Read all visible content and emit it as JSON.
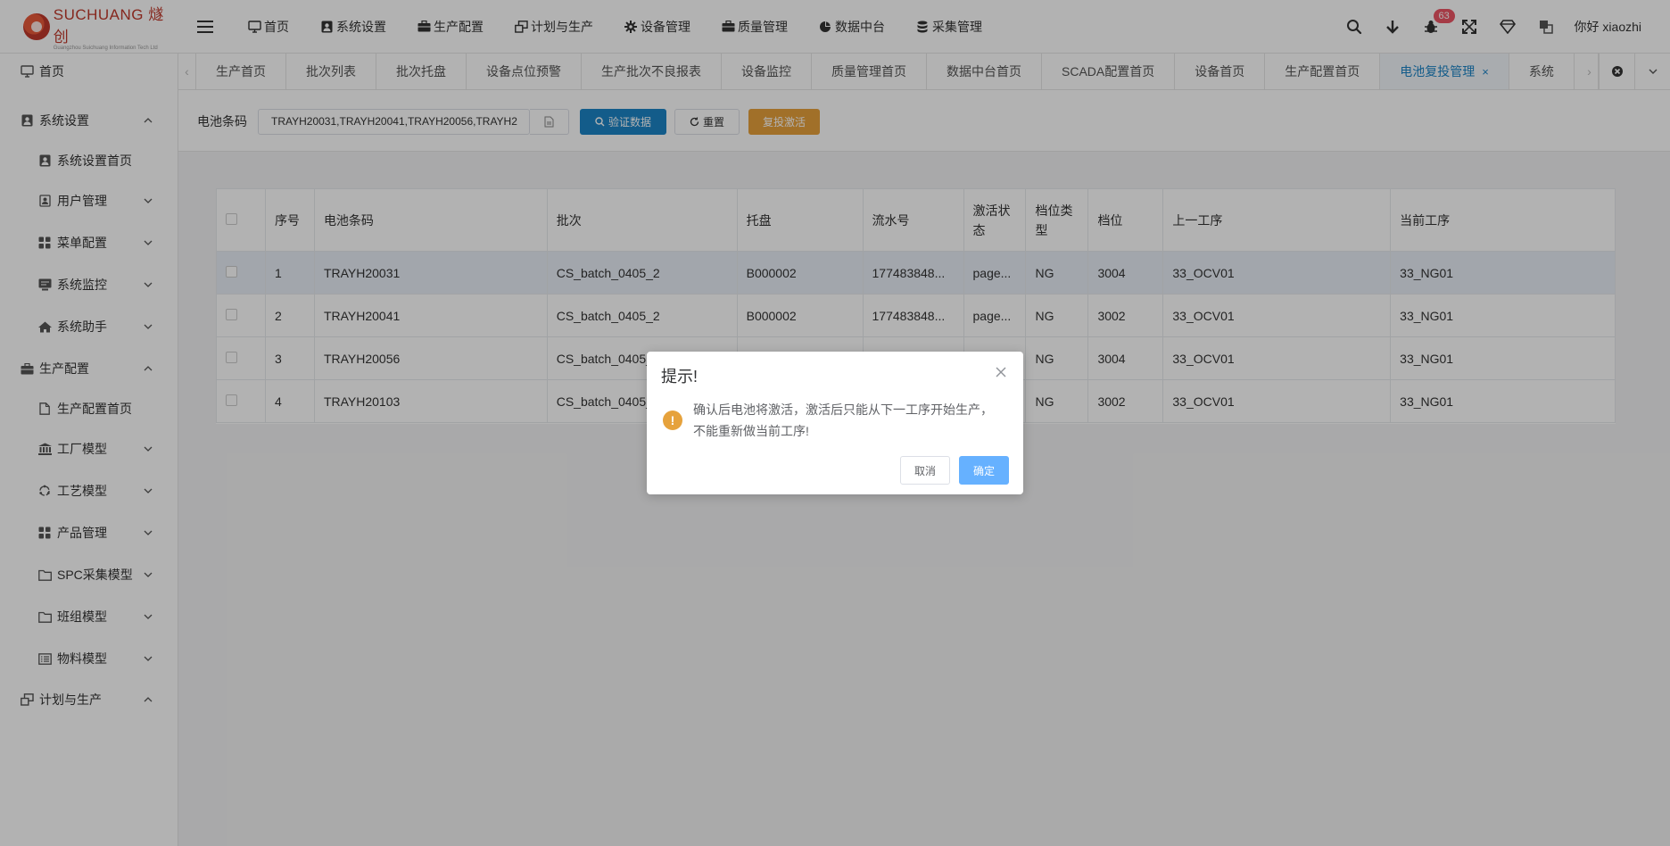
{
  "brand": {
    "name": "SUCHUANG 燧创",
    "tagline": "Guangzhou Suichuang Information Tech Ltd"
  },
  "topnav": [
    {
      "label": "首页",
      "icon": "monitor-icon"
    },
    {
      "label": "系统设置",
      "icon": "user-badge-icon"
    },
    {
      "label": "生产配置",
      "icon": "briefcase-icon"
    },
    {
      "label": "计划与生产",
      "icon": "windows-icon"
    },
    {
      "label": "设备管理",
      "icon": "gear-icon"
    },
    {
      "label": "质量管理",
      "icon": "briefcase-icon"
    },
    {
      "label": "数据中台",
      "icon": "pie-chart-icon"
    },
    {
      "label": "采集管理",
      "icon": "database-icon"
    }
  ],
  "header": {
    "badge_count": "63",
    "greeting": "你好 xiaozhi"
  },
  "sidebar": [
    {
      "label": "首页",
      "level": 1,
      "icon": "monitor-icon",
      "expand": ""
    },
    {
      "label": "系统设置",
      "level": 1,
      "icon": "user-badge-icon",
      "expand": "up"
    },
    {
      "label": "系统设置首页",
      "level": 2,
      "icon": "user-badge-icon",
      "expand": ""
    },
    {
      "label": "用户管理",
      "level": 2,
      "icon": "id-card-icon",
      "expand": "down"
    },
    {
      "label": "菜单配置",
      "level": 2,
      "icon": "grid-icon",
      "expand": "down"
    },
    {
      "label": "系统监控",
      "level": 2,
      "icon": "display-icon",
      "expand": "down"
    },
    {
      "label": "系统助手",
      "level": 2,
      "icon": "home-icon",
      "expand": "down"
    },
    {
      "label": "生产配置",
      "level": 1,
      "icon": "briefcase-icon",
      "expand": "up"
    },
    {
      "label": "生产配置首页",
      "level": 2,
      "icon": "file-icon",
      "expand": ""
    },
    {
      "label": "工厂模型",
      "level": 2,
      "icon": "bank-icon",
      "expand": "down"
    },
    {
      "label": "工艺模型",
      "level": 2,
      "icon": "cycle-icon",
      "expand": "down"
    },
    {
      "label": "产品管理",
      "level": 2,
      "icon": "grid-icon",
      "expand": "down"
    },
    {
      "label": "SPC采集模型",
      "level": 2,
      "icon": "folder-icon",
      "expand": "down"
    },
    {
      "label": "班组模型",
      "level": 2,
      "icon": "folder-icon",
      "expand": "down"
    },
    {
      "label": "物料模型",
      "level": 2,
      "icon": "list-icon",
      "expand": "down"
    },
    {
      "label": "计划与生产",
      "level": 1,
      "icon": "windows-icon",
      "expand": "up"
    }
  ],
  "tabs": [
    {
      "label": "生产首页",
      "active": false
    },
    {
      "label": "批次列表",
      "active": false
    },
    {
      "label": "批次托盘",
      "active": false
    },
    {
      "label": "设备点位预警",
      "active": false
    },
    {
      "label": "生产批次不良报表",
      "active": false
    },
    {
      "label": "设备监控",
      "active": false
    },
    {
      "label": "质量管理首页",
      "active": false
    },
    {
      "label": "数据中台首页",
      "active": false
    },
    {
      "label": "SCADA配置首页",
      "active": false
    },
    {
      "label": "设备首页",
      "active": false
    },
    {
      "label": "生产配置首页",
      "active": false
    },
    {
      "label": "电池复投管理",
      "active": true
    },
    {
      "label": "系统",
      "active": false
    }
  ],
  "search": {
    "label": "电池条码",
    "value": "TRAYH20031,TRAYH20041,TRAYH20056,TRAYH2",
    "verify_button": "验证数据",
    "reset_button": "重置",
    "reactivate_button": "复投激活"
  },
  "table": {
    "columns": [
      "序号",
      "电池条码",
      "批次",
      "托盘",
      "流水号",
      "激活状态",
      "档位类型",
      "档位",
      "上一工序",
      "当前工序"
    ],
    "rows": [
      [
        "1",
        "TRAYH20031",
        "CS_batch_0405_2",
        "B000002",
        "177483848...",
        "page...",
        "NG",
        "3004",
        "33_OCV01",
        "33_NG01"
      ],
      [
        "2",
        "TRAYH20041",
        "CS_batch_0405_2",
        "B000002",
        "177483848...",
        "page...",
        "NG",
        "3002",
        "33_OCV01",
        "33_NG01"
      ],
      [
        "3",
        "TRAYH20056",
        "CS_batch_0405_",
        "",
        "",
        "",
        "NG",
        "3004",
        "33_OCV01",
        "33_NG01"
      ],
      [
        "4",
        "TRAYH20103",
        "CS_batch_0405_",
        "",
        "",
        "",
        "NG",
        "3002",
        "33_OCV01",
        "33_NG01"
      ]
    ],
    "highlight_row": 0
  },
  "modal": {
    "title": "提示!",
    "message_line1": "确认后电池将激活，激活后只能从下一工序开始生产，",
    "message_line2": "不能重新做当前工序!",
    "cancel": "取消",
    "ok": "确定"
  },
  "colors": {
    "primary": "#1c84c6",
    "warning": "#e7a13c",
    "badge": "#ed5565",
    "modal_ok": "#66b1ff"
  }
}
